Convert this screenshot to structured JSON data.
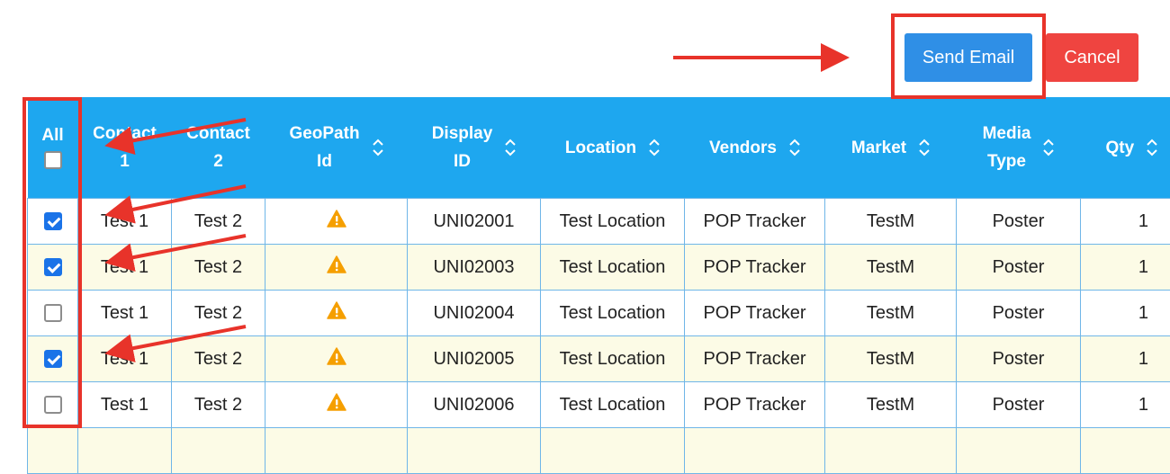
{
  "toolbar": {
    "send_email_label": "Send Email",
    "cancel_label": "Cancel"
  },
  "table": {
    "select_all_label": "All",
    "headers": {
      "contact1": [
        "Contact",
        "1"
      ],
      "contact2": [
        "Contact",
        "2"
      ],
      "geopath": [
        "GeoPath",
        "Id"
      ],
      "display": [
        "Display",
        "ID"
      ],
      "location": "Location",
      "vendors": "Vendors",
      "market": "Market",
      "media_type": [
        "Media",
        "Type"
      ],
      "qty": "Qty"
    },
    "rows": [
      {
        "checked": true,
        "contact1": "Test 1",
        "contact2": "Test 2",
        "display_id": "UNI02001",
        "location": "Test Location",
        "vendor": "POP Tracker",
        "market": "TestM",
        "media_type": "Poster",
        "qty": "1"
      },
      {
        "checked": true,
        "contact1": "Test 1",
        "contact2": "Test 2",
        "display_id": "UNI02003",
        "location": "Test Location",
        "vendor": "POP Tracker",
        "market": "TestM",
        "media_type": "Poster",
        "qty": "1"
      },
      {
        "checked": false,
        "contact1": "Test 1",
        "contact2": "Test 2",
        "display_id": "UNI02004",
        "location": "Test Location",
        "vendor": "POP Tracker",
        "market": "TestM",
        "media_type": "Poster",
        "qty": "1"
      },
      {
        "checked": true,
        "contact1": "Test 1",
        "contact2": "Test 2",
        "display_id": "UNI02005",
        "location": "Test Location",
        "vendor": "POP Tracker",
        "market": "TestM",
        "media_type": "Poster",
        "qty": "1"
      },
      {
        "checked": false,
        "contact1": "Test 1",
        "contact2": "Test 2",
        "display_id": "UNI02006",
        "location": "Test Location",
        "vendor": "POP Tracker",
        "market": "TestM",
        "media_type": "Poster",
        "qty": "1"
      }
    ]
  },
  "colors": {
    "header_bg": "#1ea7ef",
    "send_button": "#2f8fe6",
    "cancel_button": "#ef4440",
    "annotation_red": "#e8332a",
    "display_id_red": "#e03131",
    "link_blue": "#2a86d6",
    "alt_row": "#fcfbe6",
    "warning_orange": "#f59f00"
  },
  "icons": [
    "warning-icon",
    "sort-icon",
    "checkbox-icon"
  ]
}
